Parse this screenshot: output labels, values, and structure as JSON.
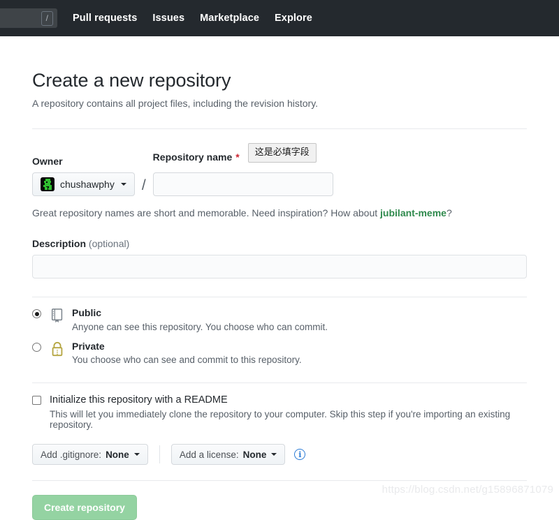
{
  "header": {
    "search": {
      "placeholder": "",
      "value": "",
      "shortcut_key": "/"
    },
    "nav_links": [
      {
        "label": "Pull requests"
      },
      {
        "label": "Issues"
      },
      {
        "label": "Marketplace"
      },
      {
        "label": "Explore"
      }
    ]
  },
  "page": {
    "title": "Create a new repository",
    "subtitle": "A repository contains all project files, including the revision history."
  },
  "owner": {
    "label": "Owner",
    "name": "chushawphy"
  },
  "repo_name": {
    "label": "Repository name",
    "required_marker": "*",
    "value": "",
    "placeholder": "",
    "validation_tooltip": "这是必填字段"
  },
  "separator": "/",
  "hint": {
    "prefix": "Great repository names are short and memorable. Need inspiration? How about ",
    "suggestion": "jubilant-meme",
    "suffix": "?"
  },
  "description": {
    "label": "Description",
    "optional_label": "(optional)",
    "value": "",
    "placeholder": ""
  },
  "visibility": {
    "options": [
      {
        "title": "Public",
        "description": "Anyone can see this repository. You choose who can commit.",
        "selected": true,
        "icon": "repo-book-icon"
      },
      {
        "title": "Private",
        "description": "You choose who can see and commit to this repository.",
        "selected": false,
        "icon": "lock-icon"
      }
    ]
  },
  "readme": {
    "label": "Initialize this repository with a README",
    "checked": false,
    "description": "This will let you immediately clone the repository to your computer. Skip this step if you're importing an existing repository."
  },
  "dropdowns": [
    {
      "prefix": "Add .gitignore: ",
      "value": "None"
    },
    {
      "prefix": "Add a license: ",
      "value": "None"
    }
  ],
  "info_icon_glyph": "i",
  "submit": {
    "label": "Create repository",
    "enabled": false
  },
  "watermark": "https://blog.csdn.net/g15896871079",
  "colors": {
    "header_bg": "#24292e",
    "accent_green": "#2f8a4d",
    "required_red": "#cb2431",
    "button_green_disabled": "#94d3a2",
    "lock_icon": "#b5a642",
    "info_blue": "#2b7bd6"
  }
}
